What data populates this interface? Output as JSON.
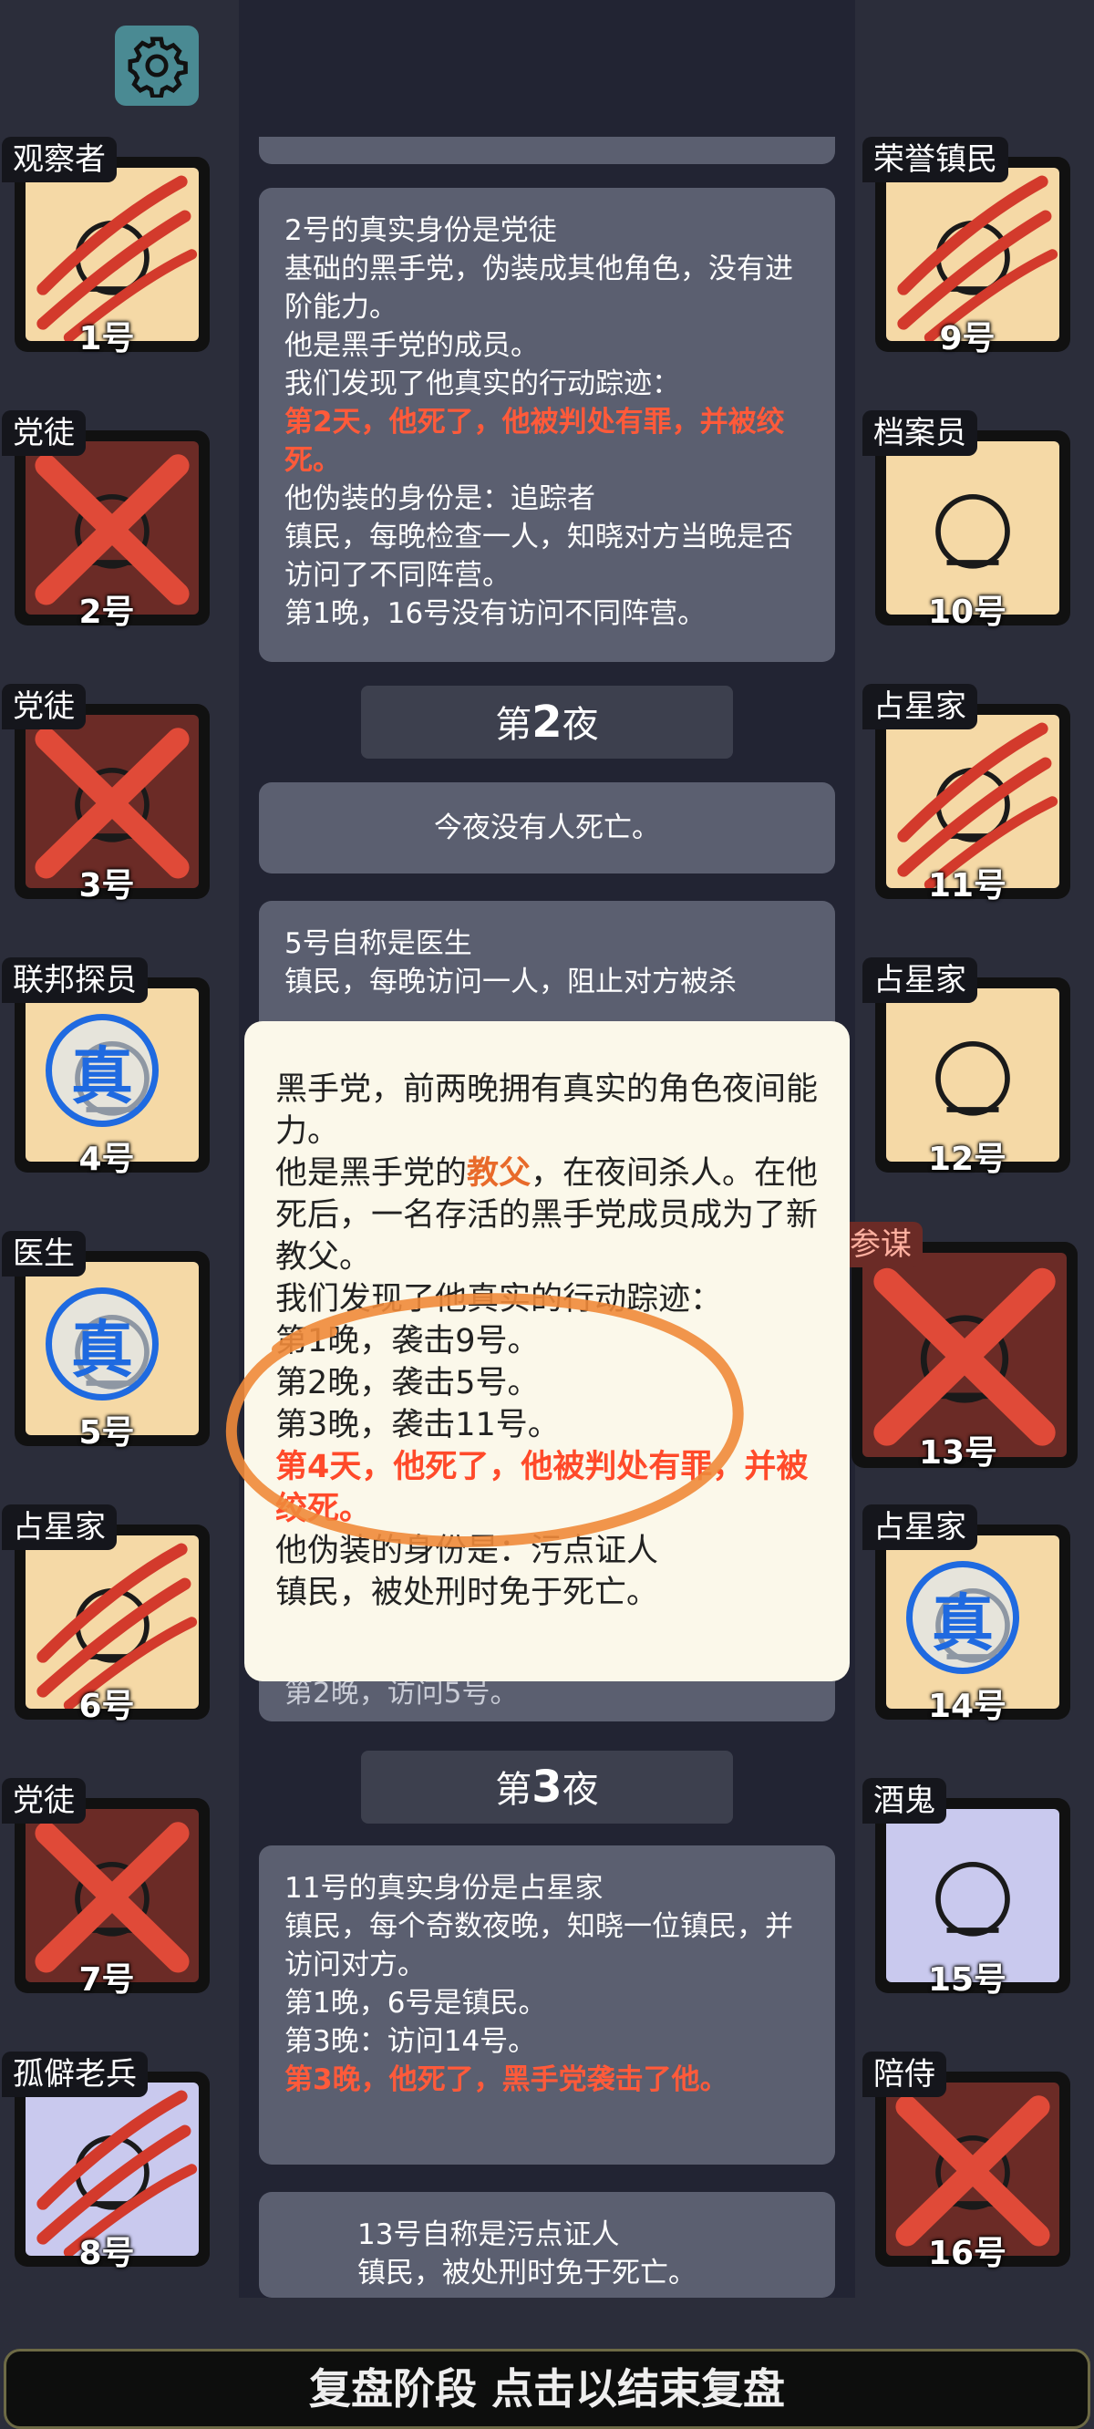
{
  "bottom_bar": "复盘阶段 点击以结束复盘",
  "left_players": [
    {
      "role": "观察者",
      "number": "1号",
      "status": "claw",
      "bg": "tan"
    },
    {
      "role": "党徒",
      "number": "2号",
      "status": "dead",
      "bg": "dark"
    },
    {
      "role": "党徒",
      "number": "3号",
      "status": "dead",
      "bg": "dark"
    },
    {
      "role": "联邦探员",
      "number": "4号",
      "status": "true",
      "bg": "tan"
    },
    {
      "role": "医生",
      "number": "5号",
      "status": "true",
      "bg": "tan"
    },
    {
      "role": "占星家",
      "number": "6号",
      "status": "claw",
      "bg": "tan"
    },
    {
      "role": "党徒",
      "number": "7号",
      "status": "dead",
      "bg": "dark"
    },
    {
      "role": "孤僻老兵",
      "number": "8号",
      "status": "claw",
      "bg": "lav"
    }
  ],
  "right_players": [
    {
      "role": "荣誉镇民",
      "number": "9号",
      "status": "claw",
      "bg": "tan"
    },
    {
      "role": "档案员",
      "number": "10号",
      "status": "none",
      "bg": "tan"
    },
    {
      "role": "占星家",
      "number": "11号",
      "status": "claw",
      "bg": "tan"
    },
    {
      "role": "占星家",
      "number": "12号",
      "status": "none",
      "bg": "tan"
    },
    {
      "role": "参谋",
      "number": "13号",
      "status": "dead",
      "bg": "dark"
    },
    {
      "role": "占星家",
      "number": "14号",
      "status": "true",
      "bg": "tan"
    },
    {
      "role": "酒鬼",
      "number": "15号",
      "status": "none",
      "bg": "lav"
    },
    {
      "role": "陪侍",
      "number": "16号",
      "status": "dead",
      "bg": "dark"
    }
  ],
  "true_badge": "真",
  "log": {
    "box1": [
      "2号的真实身份是党徒",
      "基础的黑手党，伪装成其他角色，没有进阶能力。",
      "他是黑手党的成员。",
      "我们发现了他真实的行动踪迹：",
      "第2天，他死了，他被判处有罪，并被绞死。",
      "他伪装的身份是：追踪者",
      "镇民，每晚检查一人，知晓对方当晚是否访问了不同阵营。",
      "第1晚，16号没有访问不同阵营。"
    ],
    "night2_prefix": "第",
    "night2_num": "2",
    "night2_suffix": "夜",
    "box2": "今夜没有人死亡。",
    "box3": [
      "5号自称是医生",
      "镇民，每晚访问一人，阻止对方被杀"
    ],
    "box4_tail": "第2晚，访问5号。",
    "night3_prefix": "第",
    "night3_num": "3",
    "night3_suffix": "夜",
    "box5": [
      "11号的真实身份是占星家",
      "镇民，每个奇数夜晚，知晓一位镇民，并访问对方。",
      "第1晚，6号是镇民。",
      "第3晚：访问14号。",
      "第3晚，他死了，黑手党袭击了他。"
    ],
    "box6": [
      "13号自称是污点证人",
      "镇民，被处刑时免于死亡。"
    ]
  },
  "popup": {
    "line1": "黑手党，前两晚拥有真实的角色夜间能力。",
    "line2a": "他是黑手党的",
    "line2b": "教父",
    "line2c": "，在夜间杀人。在他死后，一名存活的黑手党成员成为了新教父。",
    "line3": "我们发现了他真实的行动踪迹：",
    "line4": "第1晚，袭击9号。",
    "line5": "第2晚，袭击5号。",
    "line6": "第3晚，袭击11号。",
    "line7": "第4天，他死了，他被判处有罪，并被绞死。",
    "line8": "他伪装的身份是：污点证人",
    "line9": "镇民，被处刑时免于死亡。"
  }
}
